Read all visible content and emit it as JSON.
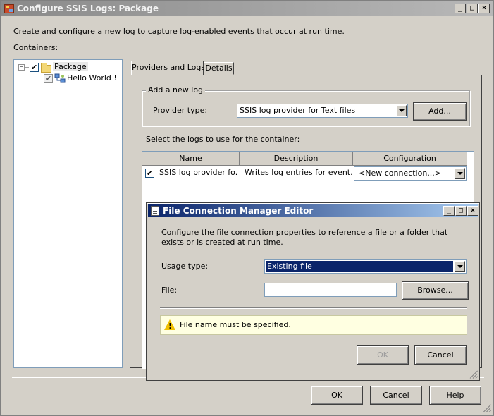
{
  "main_window": {
    "title": "Configure SSIS Logs: Package",
    "caption_buttons": {
      "minimize": "_",
      "maximize": "□",
      "close": "×"
    },
    "description": "Create and configure a new log to capture log-enabled events that occur at run time.",
    "containers_label": "Containers:",
    "tree": {
      "root": {
        "label": "Package",
        "checked": true,
        "expanded": true,
        "toggle": "−"
      },
      "child": {
        "label": "Hello World !",
        "checked": true
      }
    },
    "tabs": [
      {
        "label": "Providers and Logs",
        "active": true
      },
      {
        "label": "Details",
        "active": false
      }
    ],
    "add_log": {
      "group_label": "Add a new log",
      "provider_label": "Provider type:",
      "provider_value": "SSIS log provider for Text files",
      "add_button": "Add..."
    },
    "logs_label": "Select the logs to use for the container:",
    "logs_table": {
      "columns": [
        "Name",
        "Description",
        "Configuration"
      ],
      "rows": [
        {
          "checked": true,
          "name": "SSIS log provider fo...",
          "description": "Writes log entries for event...",
          "configuration": "<New connection...>"
        }
      ]
    },
    "buttons": {
      "ok": "OK",
      "cancel": "Cancel",
      "help": "Help"
    }
  },
  "file_connection_editor": {
    "title": "File Connection Manager Editor",
    "caption_buttons": {
      "minimize": "_",
      "maximize": "□",
      "close": "×"
    },
    "description": "Configure the file connection properties to reference a file or a folder that exists or is created at run time.",
    "usage_label": "Usage type:",
    "usage_value": "Existing file",
    "file_label": "File:",
    "file_value": "",
    "browse_button": "Browse...",
    "warning": "File name must be specified.",
    "warning_icon": "warning-icon",
    "buttons": {
      "ok": "OK",
      "cancel": "Cancel"
    }
  },
  "colors": {
    "dialog_background": "#d4d0c8",
    "active_title_start": "#0a246a",
    "active_title_end": "#a6caf0",
    "selection": "#0a246a",
    "warning_background": "#ffffe1"
  }
}
